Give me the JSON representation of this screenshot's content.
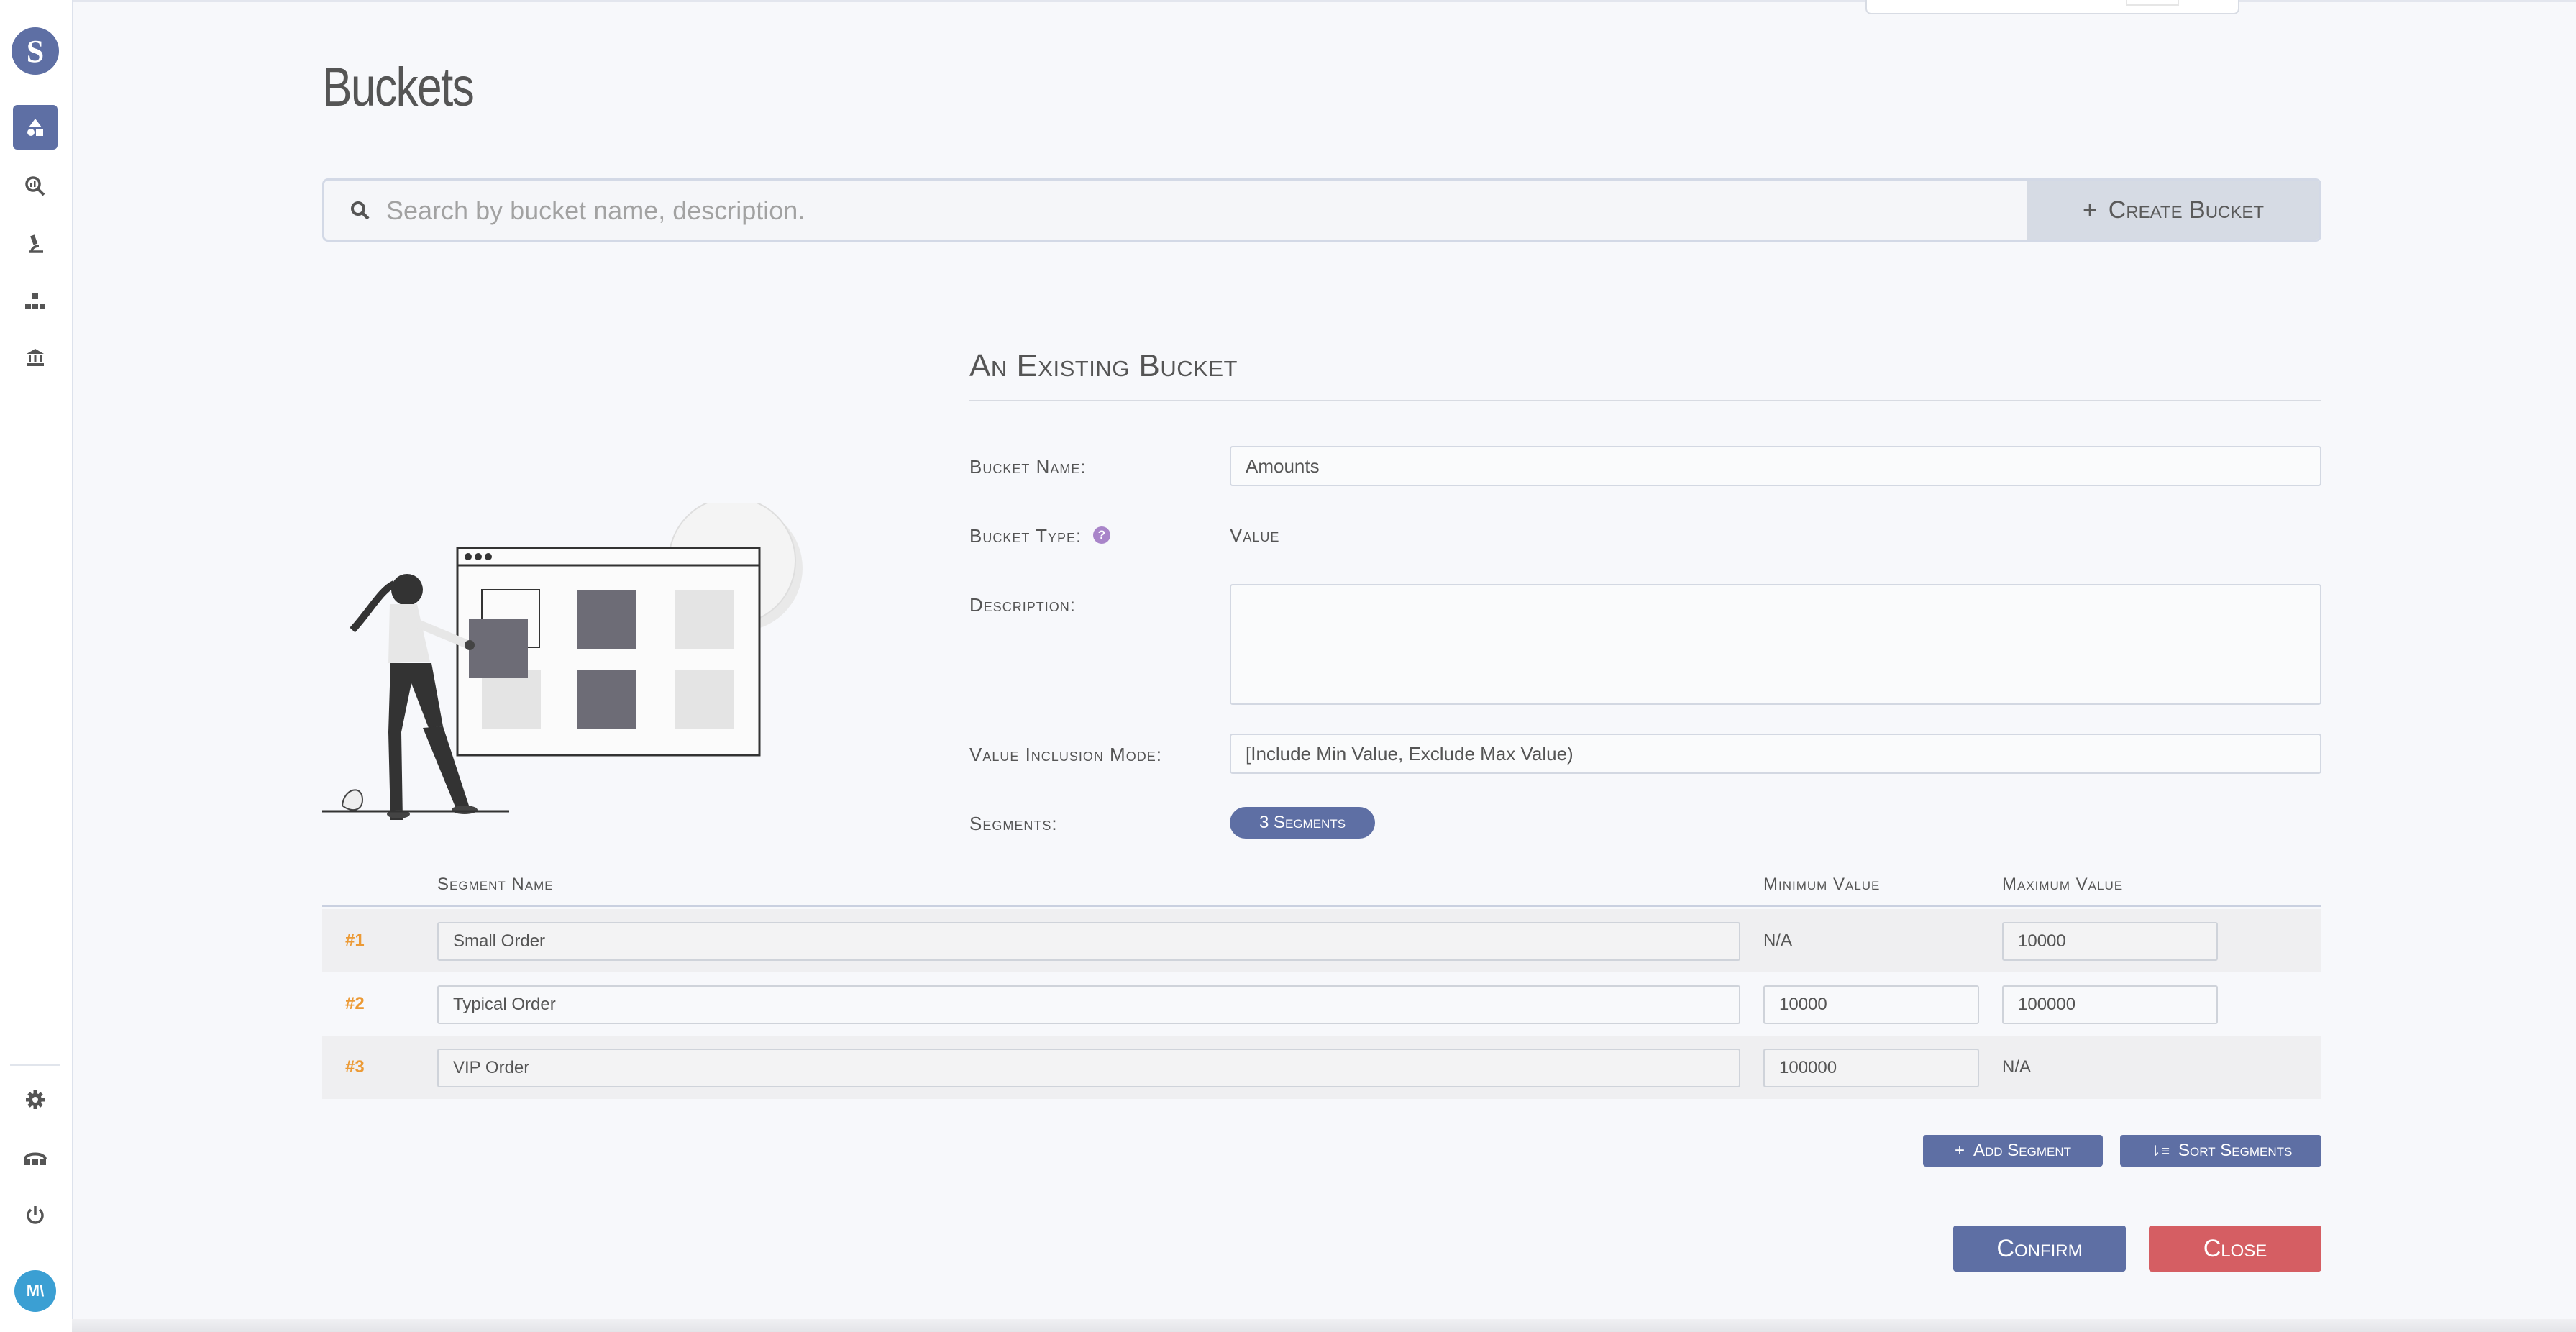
{
  "app": {
    "logo_letter": "S",
    "avatar_initials": "M\\"
  },
  "sidebar": {
    "items": [
      {
        "name": "buckets",
        "icon": "shapes-icon",
        "glyph": "▲",
        "active": true
      },
      {
        "name": "explore",
        "icon": "search-chart-icon",
        "glyph": "⌕"
      },
      {
        "name": "lab",
        "icon": "microscope-icon",
        "glyph": "⚗"
      },
      {
        "name": "hierarchy",
        "icon": "hierarchy-icon",
        "glyph": "⚇"
      },
      {
        "name": "bank",
        "icon": "bank-icon",
        "glyph": "⌂"
      }
    ],
    "bottom_items": [
      {
        "name": "settings",
        "icon": "gear-icon",
        "glyph": "⚙"
      },
      {
        "name": "integrations",
        "icon": "network-icon",
        "glyph": "⛬"
      },
      {
        "name": "logout",
        "icon": "power-icon",
        "glyph": "⏻"
      }
    ]
  },
  "page": {
    "title": "Buckets"
  },
  "search": {
    "placeholder": "Search by bucket name, description.",
    "value": ""
  },
  "toolbar": {
    "create_label": "Create Bucket",
    "create_icon": "+"
  },
  "form": {
    "section_title": "An Existing Bucket",
    "name_label": "Bucket Name:",
    "name_value": "Amounts",
    "type_label": "Bucket Type:",
    "type_value": "Value",
    "type_help": "?",
    "description_label": "Description:",
    "description_value": "",
    "inclusion_label": "Value Inclusion Mode:",
    "inclusion_value": "[Include Min Value, Exclude Max Value)",
    "segments_label": "Segments:",
    "segments_badge": "3 Segments"
  },
  "table": {
    "headers": {
      "name": "Segment Name",
      "min": "Minimum Value",
      "max": "Maximum Value"
    },
    "rows": [
      {
        "num": "#1",
        "name": "Small Order",
        "min": "N/A",
        "max": "10000"
      },
      {
        "num": "#2",
        "name": "Typical Order",
        "min": "10000",
        "max": "100000"
      },
      {
        "num": "#3",
        "name": "VIP Order",
        "min": "100000",
        "max": "N/A"
      }
    ]
  },
  "actions": {
    "add_segment": "Add Segment",
    "add_icon": "+",
    "sort_segments": "Sort Segments",
    "sort_icon": "⇂≡",
    "confirm": "Confirm",
    "close": "Close"
  },
  "colors": {
    "accent": "#5e6fa4",
    "danger": "#d55e63",
    "row_number": "#ec9a35",
    "help": "#a985c9"
  }
}
